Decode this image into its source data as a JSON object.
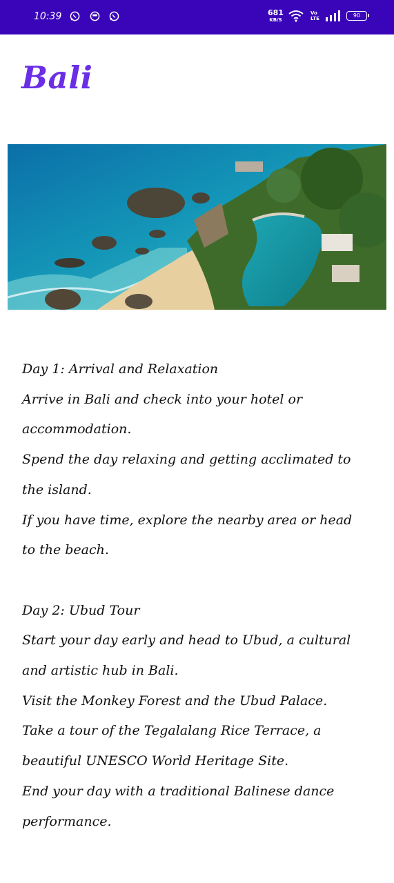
{
  "status_bar": {
    "time": "10:39",
    "net_speed_value": "681",
    "net_speed_unit": "KB/S",
    "volte_line1": "Vo",
    "volte_line2": "LTE",
    "battery_level": "90",
    "icons": [
      "whatsapp-icon",
      "circle-app-icon",
      "whatsapp-icon",
      "wifi-icon",
      "signal-icon",
      "battery-icon"
    ]
  },
  "page": {
    "title": "Bali",
    "image_alt": "Bali coastline with beach and infinity pool",
    "colors": {
      "status_bar": "#3a05b8",
      "title": "#6a2ee6"
    }
  },
  "itinerary": {
    "day1": {
      "heading": "Day 1: Arrival and Relaxation",
      "lines": [
        "Arrive in Bali and check into your hotel or",
        "accommodation.",
        "Spend the day relaxing and getting acclimated to",
        "the island.",
        "If you have time, explore the nearby area or head",
        "to the beach."
      ]
    },
    "day2": {
      "heading": "Day 2: Ubud Tour",
      "lines": [
        "Start your day early and head to Ubud, a cultural",
        "and artistic hub in Bali.",
        "Visit the Monkey Forest and the Ubud Palace.",
        "Take a tour of the Tegalalang Rice Terrace, a",
        "beautiful UNESCO World Heritage Site.",
        "End your day with a traditional Balinese dance",
        "performance."
      ]
    }
  }
}
